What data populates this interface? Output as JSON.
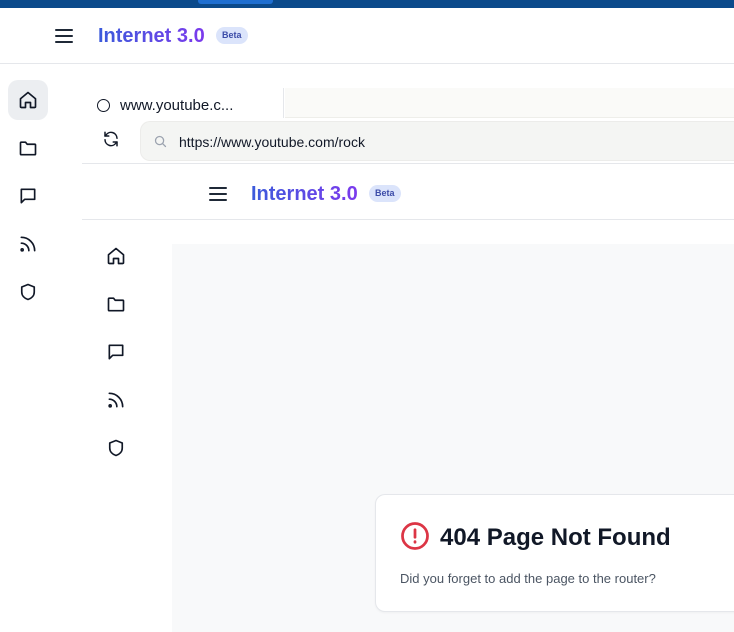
{
  "app": {
    "brand": "Internet 3.0",
    "badge": "Beta",
    "brand_gradient": [
      "#3b5bdb",
      "#7c3aed"
    ]
  },
  "sidebar": {
    "items": [
      {
        "icon": "home-icon",
        "active": true
      },
      {
        "icon": "folder-icon",
        "active": false
      },
      {
        "icon": "message-icon",
        "active": false
      },
      {
        "icon": "rss-icon",
        "active": false
      },
      {
        "icon": "shield-icon",
        "active": false
      }
    ]
  },
  "browser": {
    "tab_title": "www.youtube.c...",
    "url": "https://www.youtube.com/rock"
  },
  "inner": {
    "brand": "Internet 3.0",
    "badge": "Beta"
  },
  "error": {
    "title": "404 Page Not Found",
    "message": "Did you forget to add the page to the router?",
    "color": "#dc3545"
  }
}
